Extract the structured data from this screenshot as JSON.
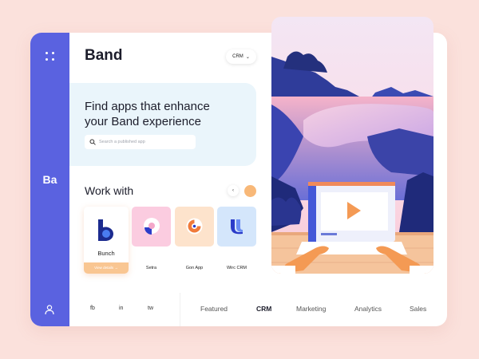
{
  "app": {
    "title": "Band",
    "sidebar_logo": "Ba",
    "category_select": "CRM"
  },
  "hero": {
    "title_line1": "Find apps that enhance",
    "title_line2": "your Band experience",
    "search_placeholder": "Search a published app"
  },
  "work_with": {
    "title": "Work with",
    "prev_arrow": "‹",
    "apps": [
      {
        "name": "Bunch",
        "action": "View details →",
        "icon": "bunch-logo"
      },
      {
        "name": "Setra",
        "icon": "setra-logo"
      },
      {
        "name": "Gon App",
        "icon": "gon-logo"
      },
      {
        "name": "Wirc CRM",
        "icon": "wirc-logo"
      }
    ]
  },
  "social": [
    "fb",
    "in",
    "tw"
  ],
  "nav_tabs": [
    "Featured",
    "CRM",
    "Marketing",
    "Analytics",
    "Sales"
  ],
  "active_tab": "CRM",
  "colors": {
    "background": "#fbe1dc",
    "sidebar": "#5a62e0",
    "accent_orange": "#f8b878",
    "hero_bg": "#eaf5fb"
  }
}
